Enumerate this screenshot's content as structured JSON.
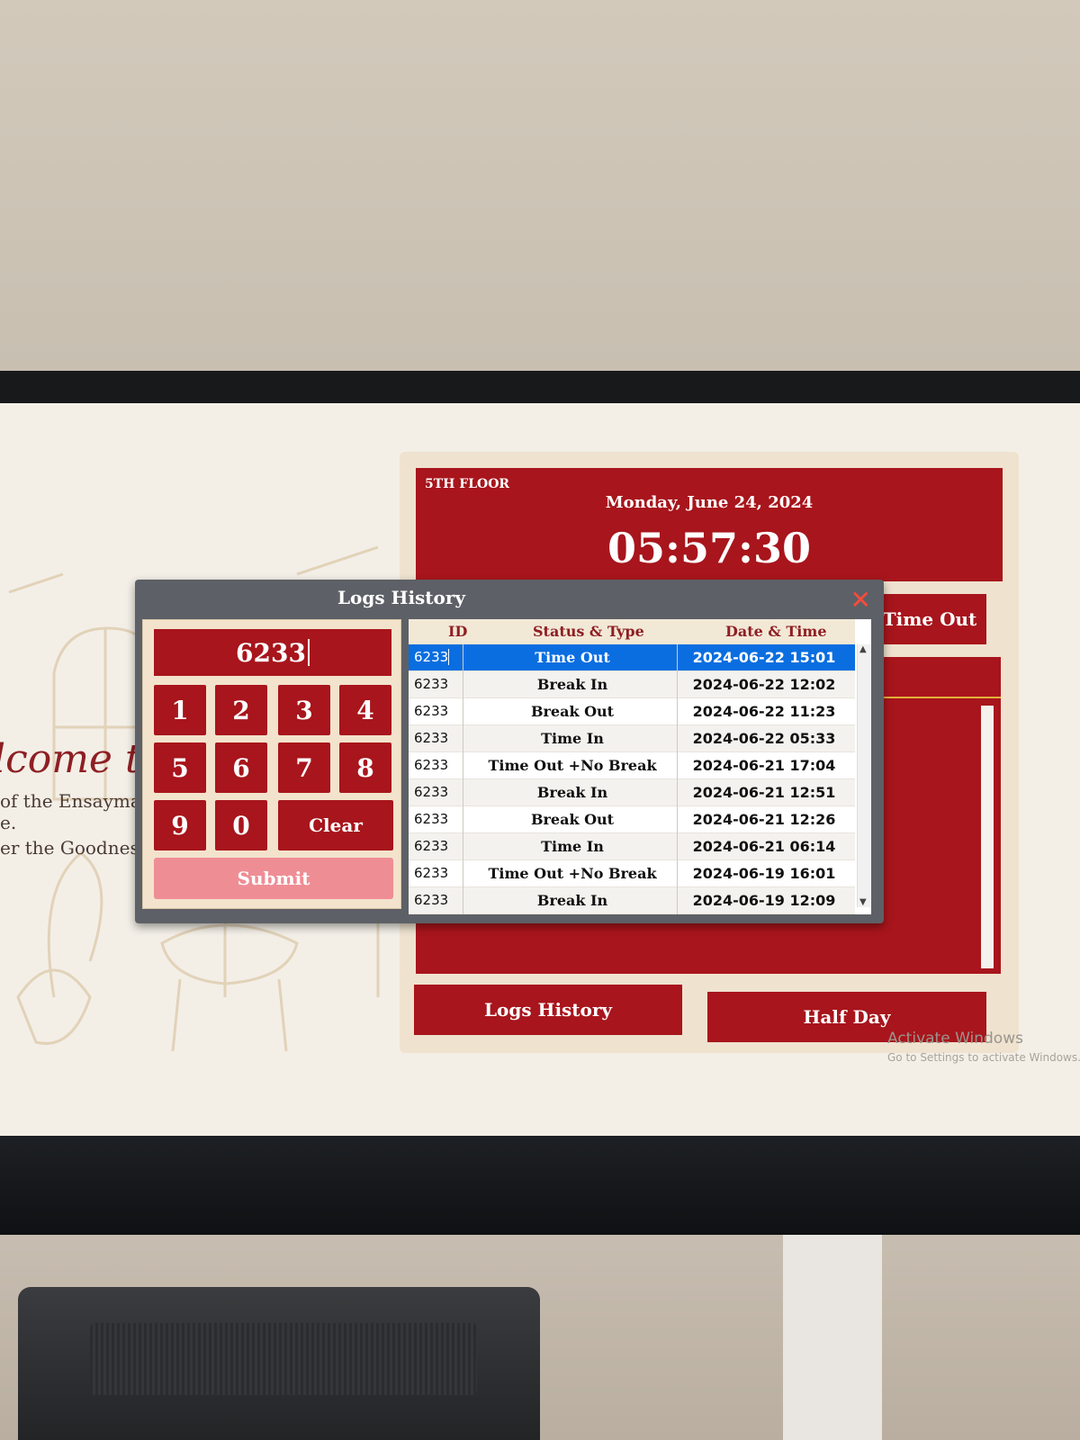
{
  "background": {
    "welcome_fragment": "lcome t",
    "tagline_1": "of the Ensaymad",
    "tagline_1b": "e.",
    "tagline_2": "er the Goodness"
  },
  "kiosk": {
    "location": "5TH FLOOR",
    "date": "Monday, June 24, 2024",
    "time": "05:57:30",
    "time_out_label": "Time Out",
    "logs_history_label": "Logs History",
    "half_day_label": "Half Day"
  },
  "dialog": {
    "title": "Logs History",
    "close_glyph": "✕",
    "pin_value": "6233",
    "keys": [
      "1",
      "2",
      "3",
      "4",
      "5",
      "6",
      "7",
      "8",
      "9",
      "0"
    ],
    "clear_label": "Clear",
    "submit_label": "Submit",
    "columns": {
      "id": "ID",
      "status": "Status & Type",
      "datetime": "Date & Time"
    },
    "rows": [
      {
        "id": "6233",
        "status": "Time Out",
        "datetime": "2024-06-22 15:01",
        "selected": true
      },
      {
        "id": "6233",
        "status": "Break In",
        "datetime": "2024-06-22 12:02"
      },
      {
        "id": "6233",
        "status": "Break Out",
        "datetime": "2024-06-22 11:23"
      },
      {
        "id": "6233",
        "status": "Time In",
        "datetime": "2024-06-22 05:33"
      },
      {
        "id": "6233",
        "status": "Time Out +No Break",
        "datetime": "2024-06-21 17:04"
      },
      {
        "id": "6233",
        "status": "Break In",
        "datetime": "2024-06-21 12:51"
      },
      {
        "id": "6233",
        "status": "Break Out",
        "datetime": "2024-06-21 12:26"
      },
      {
        "id": "6233",
        "status": "Time In",
        "datetime": "2024-06-21 06:14"
      },
      {
        "id": "6233",
        "status": "Time Out +No Break",
        "datetime": "2024-06-19 16:01"
      },
      {
        "id": "6233",
        "status": "Break In",
        "datetime": "2024-06-19 12:09"
      }
    ]
  },
  "watermark": {
    "line1": "Activate Windows",
    "line2": "Go to Settings to activate Windows."
  },
  "colors": {
    "brand_red": "#a8151c",
    "selection_blue": "#0a6ee0",
    "submit_pink": "#ef8d95",
    "close_red": "#ff4a3a"
  }
}
